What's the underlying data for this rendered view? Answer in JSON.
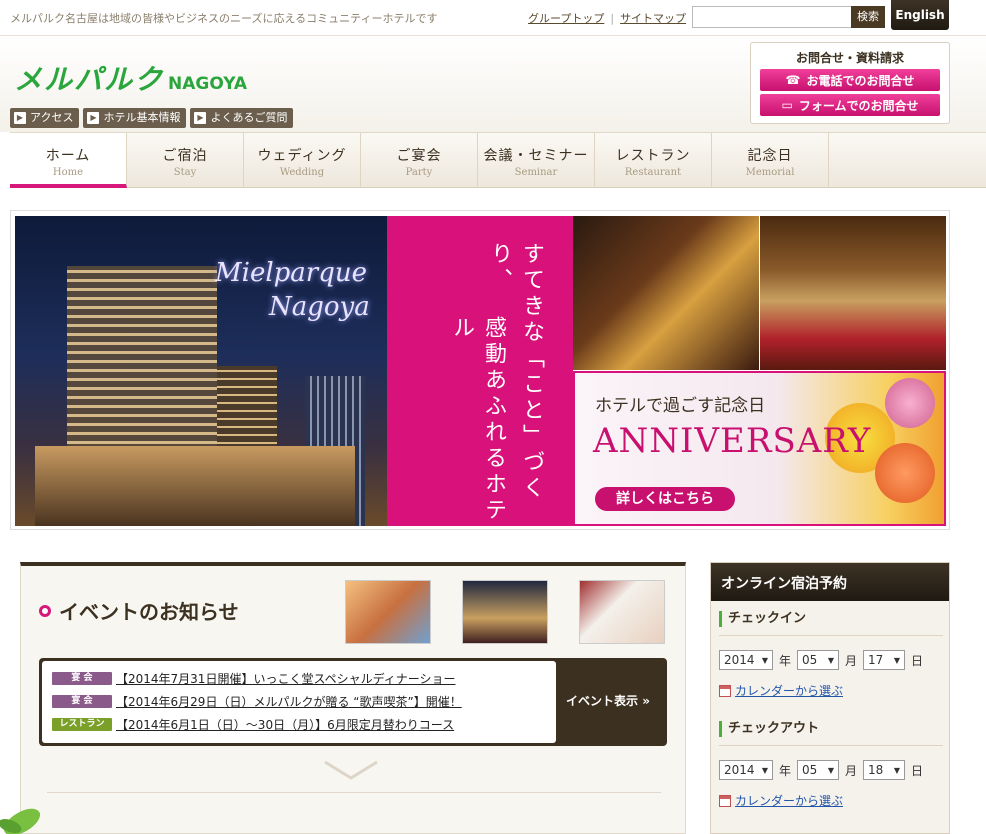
{
  "topbar": {
    "tagline": "メルパルク名古屋は地域の皆様やビジネスのニーズに応えるコミュニティーホテルです",
    "group_top": "グループトップ",
    "sitemap": "サイトマップ",
    "search_button": "検索",
    "english": "English"
  },
  "header": {
    "logo_jp": "メルパルク",
    "logo_en": "NAGOYA",
    "subnav": [
      {
        "label": "アクセス"
      },
      {
        "label": "ホテル基本情報"
      },
      {
        "label": "よくあるご質問"
      }
    ],
    "contact": {
      "title": "お問合せ・資料請求",
      "phone": "お電話でのお問合せ",
      "form": "フォームでのお問合せ"
    }
  },
  "nav": [
    {
      "jp": "ホーム",
      "en": "Home",
      "active": true
    },
    {
      "jp": "ご宿泊",
      "en": "Stay"
    },
    {
      "jp": "ウェディング",
      "en": "Wedding"
    },
    {
      "jp": "ご宴会",
      "en": "Party"
    },
    {
      "jp": "会議・セミナー",
      "en": "Seminar"
    },
    {
      "jp": "レストラン",
      "en": "Restaurant"
    },
    {
      "jp": "記念日",
      "en": "Memorial"
    }
  ],
  "hero": {
    "script_line1": "Mielparque",
    "script_line2": "Nagoya",
    "vertical_line1": "すてきな「こと」づくり、",
    "vertical_line2": "感動あふれるホテル",
    "anniv_sub": "ホテルで過ごす記念日",
    "anniv_main": "ANNIVERSARY",
    "anniv_button": "詳しくはこちら"
  },
  "events": {
    "title": "イベントのお知らせ",
    "toggle": "イベント表示",
    "items": [
      {
        "badge": "宴 会",
        "badge_color": "#8a5a8a",
        "text": "【2014年7月31日開催】いっこく堂スペシャルディナーショー"
      },
      {
        "badge": "宴 会",
        "badge_color": "#8a5a8a",
        "text": "【2014年6月29日（日）メルパルクが贈る “歌声喫茶”】開催！"
      },
      {
        "badge": "レストラン",
        "badge_color": "#7aa02a",
        "text": "【2014年6月1日（日）～30日（月）】6月限定月替わりコース"
      }
    ]
  },
  "booking": {
    "title": "オンライン宿泊予約",
    "checkin": "チェックイン",
    "checkout": "チェックアウト",
    "year_unit": "年",
    "month_unit": "月",
    "day_unit": "日",
    "calendar_link": "カレンダーから選ぶ",
    "in_year": "2014",
    "in_month": "05",
    "in_day": "17",
    "out_year": "2014",
    "out_month": "05",
    "out_day": "18"
  },
  "colors": {
    "accent": "#d6187a",
    "brand_green": "#2aa63d",
    "dark": "#3c3020"
  }
}
